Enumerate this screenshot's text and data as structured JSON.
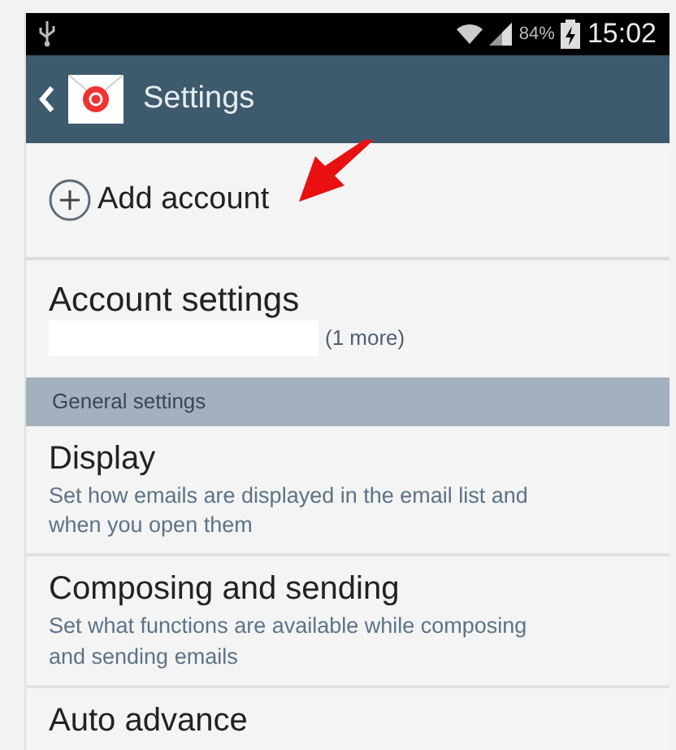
{
  "status_bar": {
    "battery": "84%",
    "time": "15:02"
  },
  "app_bar": {
    "title": "Settings"
  },
  "add_account": {
    "label": "Add account"
  },
  "account_settings": {
    "title": "Account settings",
    "more": "(1 more)"
  },
  "section_header": "General settings",
  "settings": [
    {
      "title": "Display",
      "description": "Set how emails are displayed in the email list and when you open them"
    },
    {
      "title": "Composing and sending",
      "description": "Set what functions are available while composing and sending emails"
    },
    {
      "title": "Auto advance"
    }
  ]
}
